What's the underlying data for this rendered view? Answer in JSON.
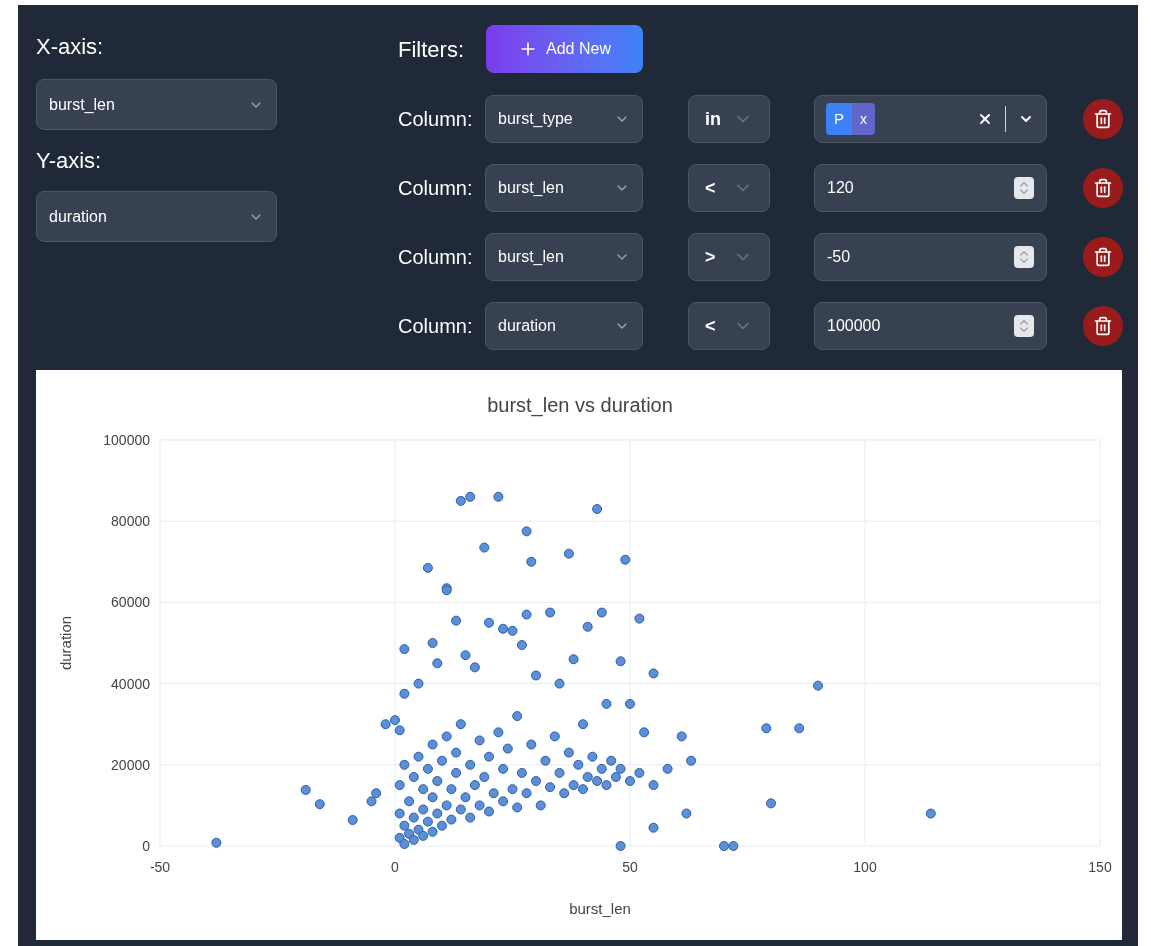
{
  "axes": {
    "x_label": "X-axis:",
    "x_value": "burst_len",
    "y_label": "Y-axis:",
    "y_value": "duration"
  },
  "filters": {
    "label": "Filters:",
    "add_button": "Add New",
    "rows": [
      {
        "kind": "tags",
        "column_label": "Column:",
        "column": "burst_type",
        "operator": "in",
        "tags": [
          {
            "label": "P",
            "remove": "x"
          }
        ]
      },
      {
        "kind": "number",
        "column_label": "Column:",
        "column": "burst_len",
        "operator": "<",
        "value": "120"
      },
      {
        "kind": "number",
        "column_label": "Column:",
        "column": "burst_len",
        "operator": ">",
        "value": "-50"
      },
      {
        "kind": "number",
        "column_label": "Column:",
        "column": "duration",
        "operator": "<",
        "value": "100000"
      }
    ]
  },
  "chart": {
    "chart_data": {
      "type": "scatter",
      "grid": true,
      "title": "burst_len vs duration",
      "xlabel": "burst_len",
      "ylabel": "duration",
      "xlim": [
        -50,
        150
      ],
      "ylim": [
        0,
        100000
      ],
      "xticks": [
        -50,
        0,
        50,
        100,
        150
      ],
      "yticks": [
        0,
        20000,
        40000,
        60000,
        80000,
        100000
      ],
      "x": [
        -38,
        -19,
        -16,
        -9,
        -5,
        -4,
        -2,
        0,
        1,
        2,
        2,
        5,
        7,
        8,
        11,
        11,
        14,
        16,
        19,
        22,
        13,
        20,
        23,
        25,
        27,
        28,
        28,
        29,
        33,
        37,
        38,
        41,
        43,
        44,
        48,
        49,
        50,
        52,
        53,
        55,
        55,
        58,
        61,
        62,
        63,
        70,
        72,
        79,
        80,
        86,
        90,
        114,
        48,
        17,
        9,
        15,
        30,
        35,
        45,
        40,
        1,
        1,
        1,
        2,
        2,
        2,
        3,
        3,
        4,
        4,
        4,
        5,
        5,
        6,
        6,
        6,
        7,
        7,
        8,
        8,
        8,
        9,
        9,
        10,
        10,
        11,
        11,
        12,
        12,
        13,
        13,
        14,
        14,
        15,
        16,
        16,
        17,
        18,
        18,
        19,
        20,
        20,
        21,
        22,
        23,
        23,
        24,
        25,
        26,
        26,
        27,
        28,
        29,
        30,
        31,
        32,
        33,
        34,
        35,
        36,
        37,
        38,
        39,
        40,
        41,
        42,
        43,
        44,
        45,
        46,
        47,
        48,
        50,
        52,
        55
      ],
      "series": [
        {
          "color": "#5b8fd8",
          "values": [
            800,
            13800,
            10300,
            6400,
            11000,
            13000,
            30000,
            31000,
            28500,
            48500,
            37500,
            40000,
            68500,
            50000,
            63500,
            63000,
            85000,
            86000,
            73500,
            86000,
            55500,
            55000,
            53500,
            53000,
            49500,
            57000,
            77500,
            70000,
            57500,
            72000,
            46000,
            54000,
            83000,
            57500,
            45500,
            70500,
            35000,
            56000,
            28000,
            42500,
            4500,
            19000,
            27000,
            8000,
            21000,
            0,
            0,
            29000,
            10500,
            29000,
            39500,
            8000,
            0,
            44000,
            45000,
            47000,
            42000,
            40000,
            35000,
            30000,
            2000,
            8000,
            15000,
            500,
            5000,
            20000,
            3000,
            11000,
            1500,
            7000,
            17000,
            4000,
            22000,
            2500,
            9000,
            14000,
            6000,
            19000,
            3500,
            12000,
            25000,
            8000,
            16000,
            5000,
            21000,
            10000,
            27000,
            6500,
            14000,
            18000,
            23000,
            9000,
            30000,
            12000,
            7000,
            20000,
            15000,
            10000,
            26000,
            17000,
            8500,
            22000,
            13000,
            28000,
            11000,
            19000,
            24000,
            14000,
            9500,
            32000,
            18000,
            13000,
            25000,
            16000,
            10000,
            21000,
            14500,
            27000,
            18000,
            13000,
            23000,
            15000,
            20000,
            14000,
            17000,
            22000,
            16000,
            19000,
            15000,
            21000,
            17000,
            19000,
            16000,
            18000,
            15000
          ]
        }
      ]
    }
  }
}
